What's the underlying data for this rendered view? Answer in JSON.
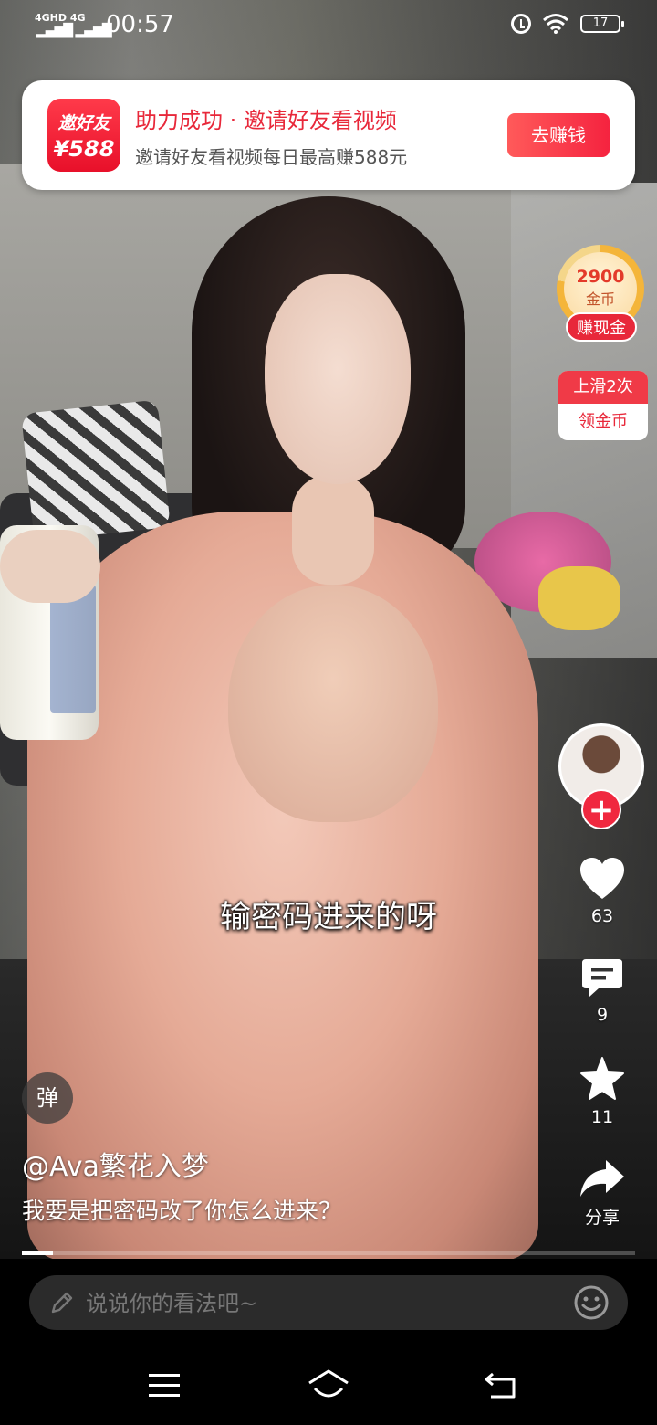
{
  "status_bar": {
    "network_label": "4GHD 4G",
    "time": "00:57",
    "battery": "17"
  },
  "invite_banner": {
    "logo_line1": "邀好友",
    "logo_line2": "¥588",
    "title": "助力成功 · 邀请好友看视频",
    "subtitle": "邀请好友看视频每日最高赚588元",
    "button": "去赚钱"
  },
  "coin_widget": {
    "amount": "2900",
    "unit": "金币",
    "cash_button": "赚现金",
    "progress": 0.78
  },
  "swipe_reward": {
    "line1": "上滑2次",
    "line2": "领金币"
  },
  "actions": {
    "likes": "63",
    "comments": "9",
    "favorites": "11",
    "share_label": "分享"
  },
  "video": {
    "subtitle": "输密码进来的呀",
    "danmu_label": "弹",
    "author": "@Ava繁花入梦",
    "caption": "我要是把密码改了你怎么进来？",
    "progress": 0.05
  },
  "comment_bar": {
    "placeholder": "说说你的看法吧~"
  },
  "icons": {
    "pencil": "pencil-icon",
    "emoji": "emoji-icon",
    "heart": "heart-icon",
    "comment": "comment-icon",
    "star": "star-icon",
    "share": "share-icon"
  },
  "colors": {
    "accent_red": "#e8283a",
    "coin_gold": "#f4b53a"
  }
}
